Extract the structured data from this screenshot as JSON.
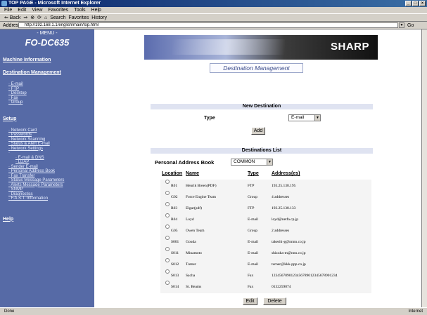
{
  "window": {
    "title": "TOP PAGE - Microsoft Internet Explorer",
    "buttons": [
      "_",
      "□",
      "×"
    ]
  },
  "menu": [
    "File",
    "Edit",
    "View",
    "Favorites",
    "Tools",
    "Help"
  ],
  "toolbar": {
    "back": "⇐ Back",
    "forward": "⇒",
    "stop": "⊗",
    "refresh": "⟳",
    "home": "⌂",
    "search": "Search",
    "favorites": "Favorites",
    "history": "History"
  },
  "address": {
    "label": "Address",
    "value": "http://192.168.1.1/english/main/top.html",
    "go": "Go"
  },
  "sidebar": {
    "menu_label": "- MENU -",
    "model": "FO-DC635",
    "sections": {
      "machine_info": "Machine Information",
      "dest_mgmt": "Destination Management",
      "setup": "Setup",
      "help": "Help"
    },
    "dest_items": [
      "E-mail",
      "FTP",
      "Desktop",
      "Fax",
      "Group"
    ],
    "setup_items": [
      "Network Card",
      "Passwords",
      "Network Scanning",
      "Status & Alert E-mail",
      "Network Settings"
    ],
    "network_sub": [
      "E-mail & DNS",
      "LDAP"
    ],
    "setup_items2": [
      "Sender E-mail",
      "Personal Address Book",
      "Fax Transfer",
      "Status Message Parameters",
      "Alerts Message Parameters",
      "SNMP",
      "Diagnostics",
      "F.A.S.T. Information"
    ]
  },
  "banner": {
    "logo": "SHARP"
  },
  "page_title": "Destination Management",
  "new_dest": {
    "header": "New Destination",
    "type_label": "Type",
    "type_value": "E-mail",
    "add_label": "Add"
  },
  "dest_list": {
    "header": "Destinations List",
    "pab_label": "Personal Address Book",
    "pab_value": "COMMON",
    "columns": [
      "Location",
      "Name",
      "Type",
      "Address(es)"
    ],
    "rows": [
      {
        "loc": "R01",
        "name": "Henrik Breen(PDF)",
        "type": "FTP",
        "addr": "193.25.138.195"
      },
      {
        "loc": "G02",
        "name": "Force Engine Team",
        "type": "Group",
        "addr": "4 addresses"
      },
      {
        "loc": "R03",
        "name": "Elgar(pdf)",
        "type": "FTP",
        "addr": "193.25.138.133"
      },
      {
        "loc": "R04",
        "name": "Loyd",
        "type": "E-mail",
        "addr": "loyd@netfa.cp.jp"
      },
      {
        "loc": "G05",
        "name": "Owen Team",
        "type": "Group",
        "addr": "2 addresses"
      },
      {
        "loc": "S001",
        "name": "Gouda",
        "type": "E-mail",
        "addr": "takeshi-g@nnnn.co.jp"
      },
      {
        "loc": "S011",
        "name": "Minamoto",
        "type": "E-mail",
        "addr": "shizuka-m@nnn.co.jp"
      },
      {
        "loc": "S012",
        "name": "Turner",
        "type": "E-mail",
        "addr": "turner@kkk-ppp.co.jp"
      },
      {
        "loc": "S013",
        "name": "Sacha",
        "type": "Fax",
        "addr": "1234567890123456789012345678901234"
      },
      {
        "loc": "S014",
        "name": "St. Beams",
        "type": "Fax",
        "addr": "0132259874"
      }
    ],
    "edit_label": "Edit",
    "delete_label": "Delete"
  },
  "status": {
    "left": "Done",
    "zone": "Internet"
  }
}
